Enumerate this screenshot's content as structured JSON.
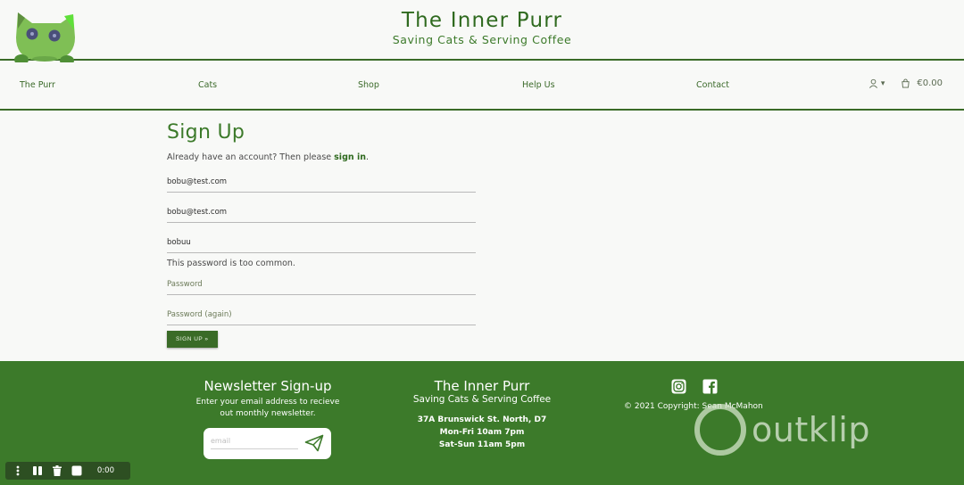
{
  "brand": {
    "title": "The Inner Purr",
    "subtitle": "Saving Cats & Serving Coffee"
  },
  "nav": {
    "items": [
      "The Purr",
      "Cats",
      "Shop",
      "Help Us",
      "Contact"
    ],
    "cart_total": "€0.00",
    "account_caret": "▾"
  },
  "signup": {
    "title": "Sign Up",
    "lead_text": "Already have an account? Then please",
    "signin_link": "sign in",
    "lead_end": ".",
    "email_value": "bobu@test.com",
    "email_confirm_value": "bobu@test.com",
    "username_value": "bobuu",
    "error_text": "This password is too common.",
    "password_placeholder": "Password",
    "password_again_placeholder": "Password (again)",
    "submit_label": "SIGN UP »"
  },
  "footer": {
    "newsletter_title": "Newsletter Sign-up",
    "newsletter_text_1": "Enter your email address to recieve",
    "newsletter_text_2": "out monthly newsletter.",
    "newsletter_placeholder": "email",
    "center_title": "The Inner Purr",
    "center_sub": "Saving Cats & Serving Coffee",
    "address": "37A Brunswick St. North, D7",
    "hours_1": "Mon-Fri 10am 7pm",
    "hours_2": "Sat-Sun 11am 5pm",
    "copyright": "© 2021 Copyright: Sean McMahon"
  },
  "watermark": {
    "text": "outklip"
  },
  "player": {
    "time": "0:00"
  },
  "colors": {
    "brand_green": "#3c7a2a",
    "dark_green": "#2f6a1f",
    "background": "#f8f9f7"
  },
  "icons": [
    "cat-logo-icon",
    "user-icon",
    "cart-icon",
    "send-icon",
    "instagram-icon",
    "facebook-icon",
    "menu-dots-icon",
    "pause-icon",
    "trash-icon",
    "stop-icon"
  ]
}
